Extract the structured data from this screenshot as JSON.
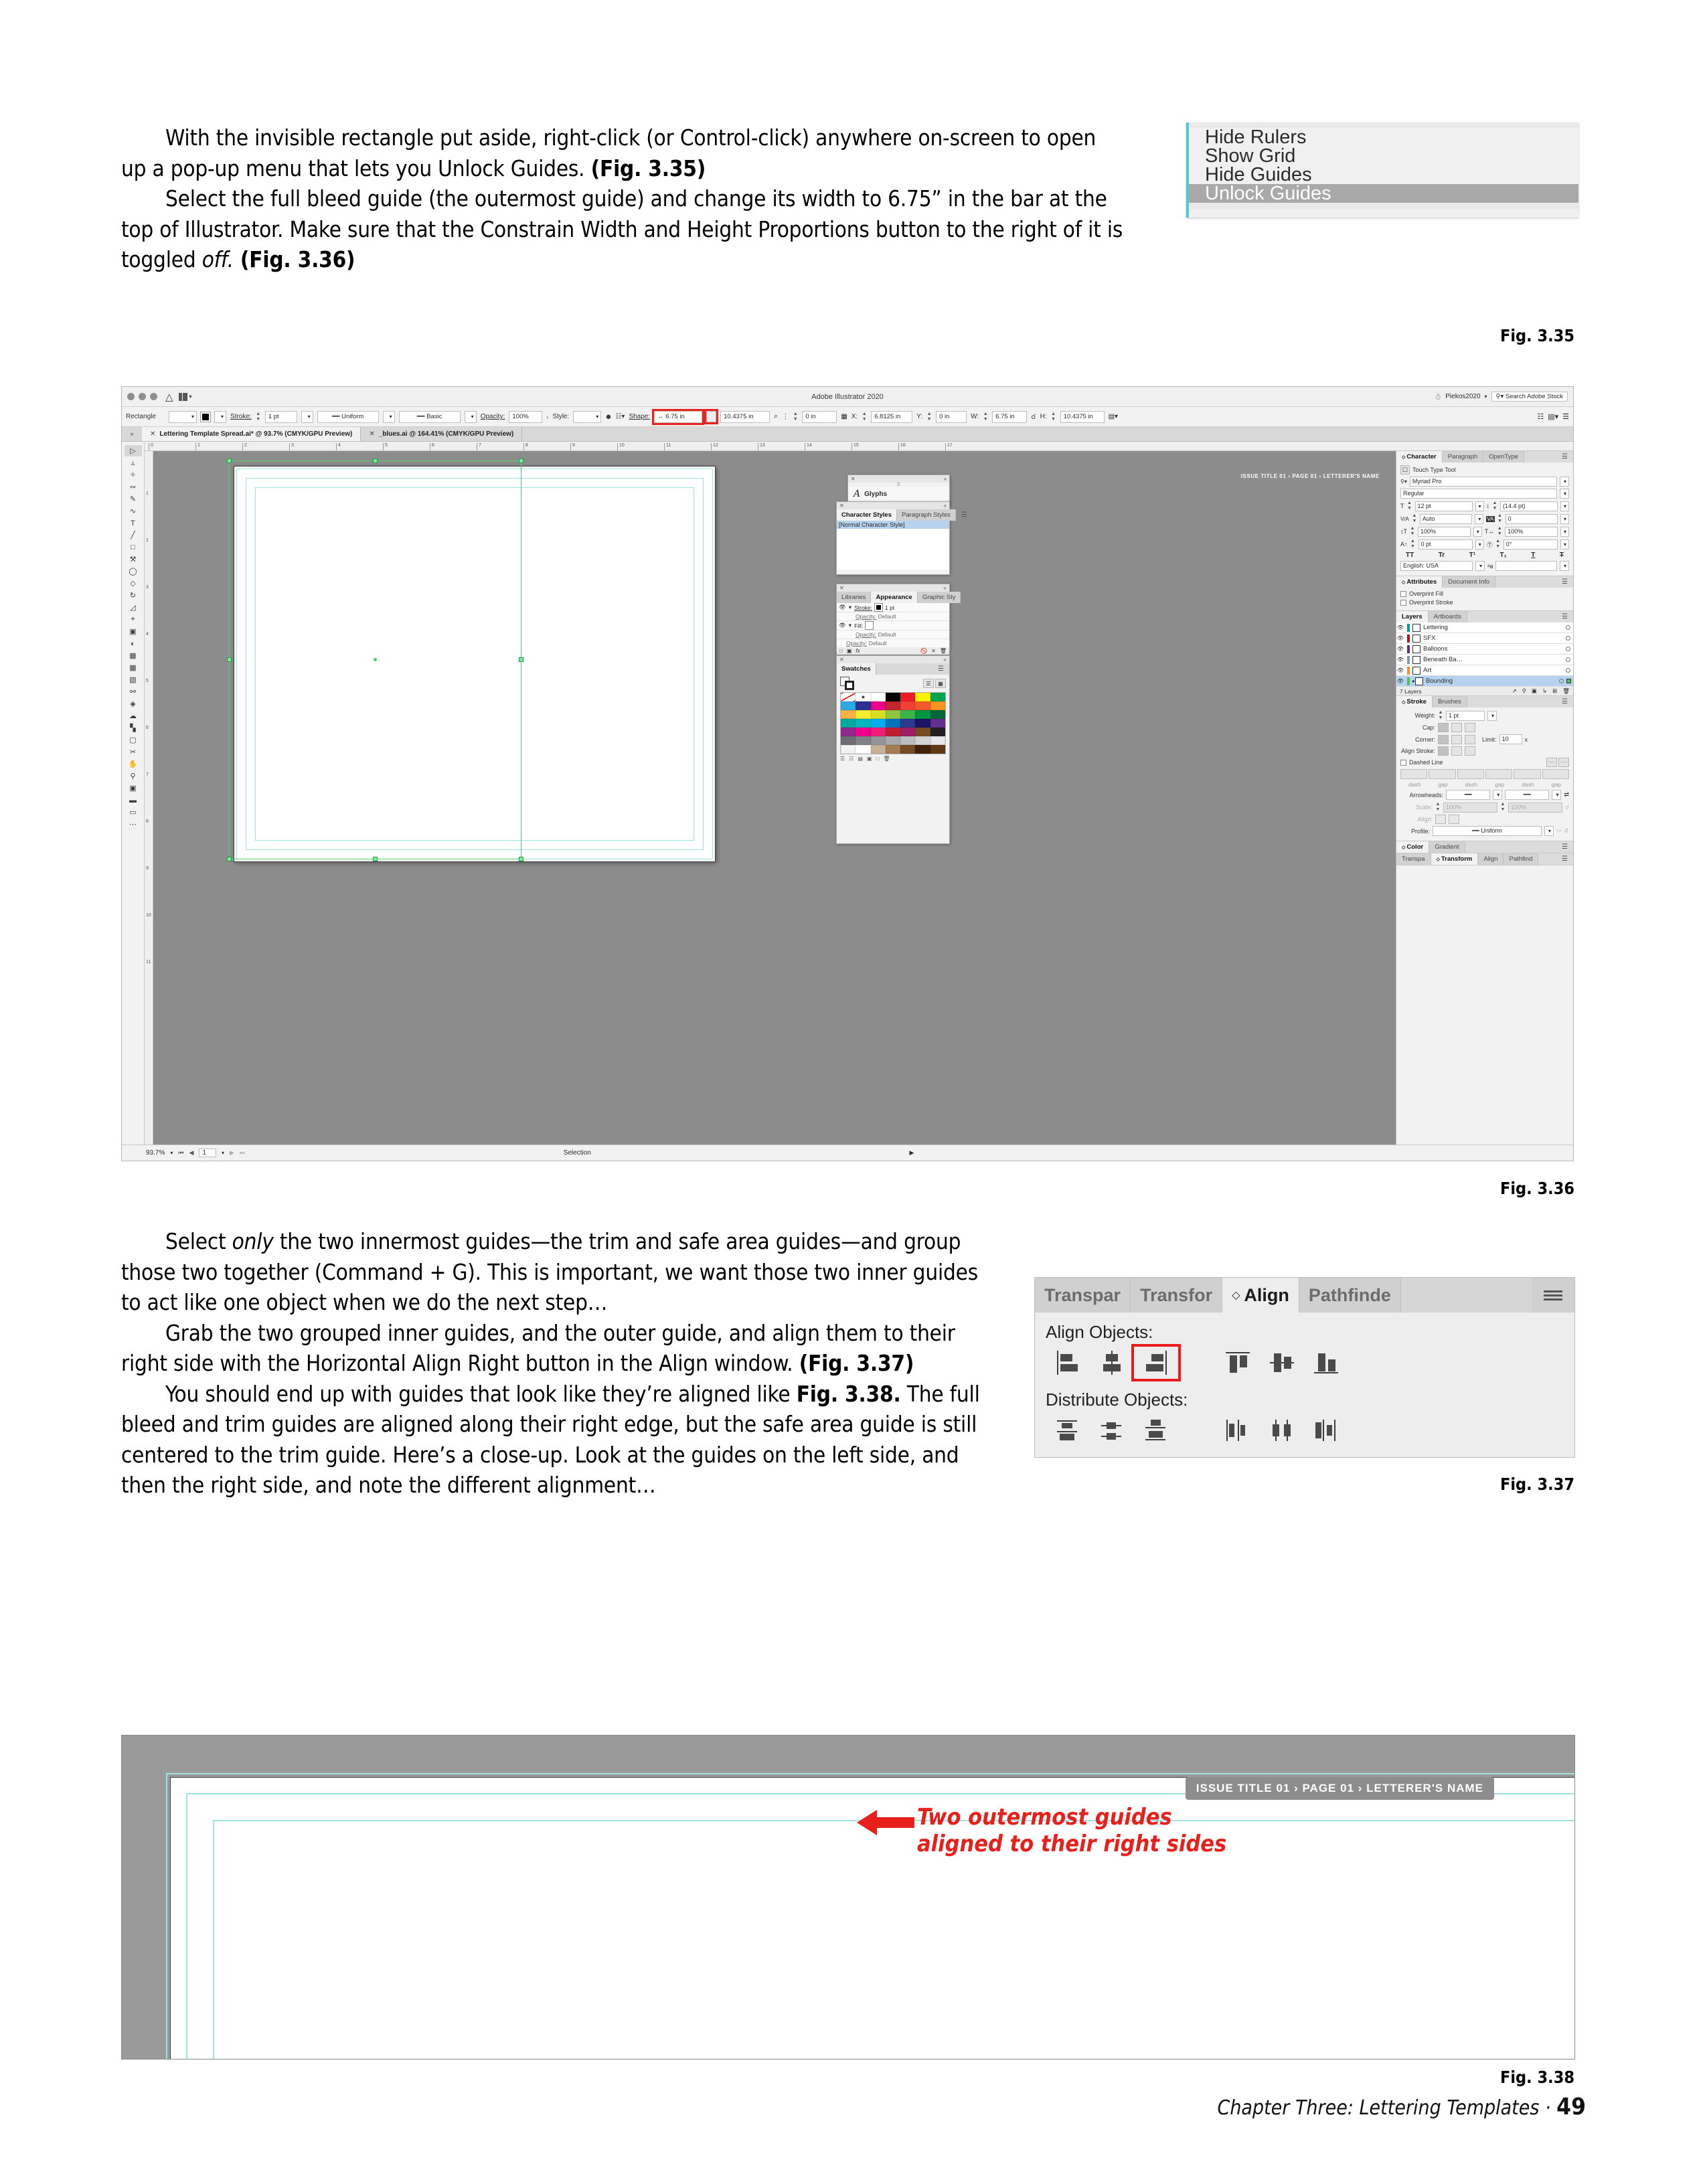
{
  "page": {
    "footer_chapter": "Chapter Three: Lettering Templates",
    "footer_sep": "·",
    "footer_page": "49"
  },
  "body": {
    "p1": "With the invisible rectangle put aside, right-click (or Control-click) anywhere on-screen to open up a pop-up menu that lets you Unlock Guides. ",
    "p1_fig": "(Fig. 3.35)",
    "p2a": "Select the full bleed guide (the outermost guide) and change its width to 6.75” in the bar at the top of Illustrator. Make sure that the Constrain Width and Height Proportions button to the right of it is toggled ",
    "p2_it": "off.",
    "p2_fig": " (Fig. 3.36)",
    "p3a": "Select ",
    "p3_it": "only",
    "p3b": " the two innermost guides—the trim and safe area guides—and group those two together (Command + G). This is important, we want those two inner guides to act like one object when we do the next step…",
    "p4a": "Grab the two grouped inner guides, and the outer guide, and align them to their right side with the Horizontal Align Right button in the Align window. ",
    "p4_fig": "(Fig. 3.37)",
    "p5a": "You should end up with guides that look like they’re aligned like ",
    "p5_fig": "Fig. 3.38.",
    "p5b": " The full bleed and trim guides are aligned along their right edge, but the safe area guide is still centered to the trim guide. Here’s a close-up. Look at the guides on the left side, and then the right side, and note the different alignment…"
  },
  "captions": {
    "fig335": "Fig. 3.35",
    "fig336": "Fig. 3.36",
    "fig337": "Fig. 3.37",
    "fig338": "Fig. 3.38"
  },
  "context_menu": {
    "items": [
      {
        "label": "Hide Rulers",
        "selected": false
      },
      {
        "label": "Show Grid",
        "selected": false
      },
      {
        "label": "Hide Guides",
        "selected": false
      },
      {
        "label": "Unlock Guides",
        "selected": true
      }
    ],
    "highlight_color": "#a9a9a9",
    "accent_color": "#57c6d4"
  },
  "illustrator": {
    "app_title": "Adobe Illustrator 2020",
    "account_name": "Piekos2020",
    "search_placeholder": "Search Adobe Stock",
    "home_icon": "home-icon",
    "workspace_icon": "workspace-switcher-icon",
    "lightbulb_icon": "discover-icon",
    "search_icon": "search-icon",
    "control_bar": {
      "object_type": "Rectangle",
      "stroke_label": "Stroke:",
      "stroke_weight": "1 pt",
      "profile": "Uniform",
      "brush": "Basic",
      "opacity_label": "Opacity:",
      "opacity_value": "100%",
      "style_label": "Style:",
      "shape_label": "Shape:",
      "width_value": "6.75 in",
      "height_value": "10.4375 in",
      "angle_value": "0 in",
      "x_label": "X:",
      "x_value": "6.8125 in",
      "y_label": "Y:",
      "y_value": "0 in",
      "w_label": "W:",
      "w_value": "6.75 in",
      "h_label": "H:",
      "h_value": "10.4375 in",
      "constrain_icon": "constrain-proportions-icon",
      "highlight_color": "#e8241f"
    },
    "document_tabs": [
      {
        "label": "Lettering Template Spread.ai* @ 93.7% (CMYK/GPU Preview)",
        "active": true
      },
      {
        "label": "_blues.ai @ 164.41% (CMYK/GPU Preview)",
        "active": false
      }
    ],
    "status_bar": {
      "zoom": "93.7%",
      "artboard": "1",
      "tool": "Selection"
    },
    "artboard_header": "ISSUE TITLE 01 › PAGE 01 › LETTERER'S NAME",
    "ruler_ticks": [
      "0",
      "1",
      "2",
      "3",
      "4",
      "5",
      "6",
      "7",
      "8",
      "9",
      "10",
      "11",
      "12",
      "13",
      "14",
      "15",
      "16",
      "17"
    ],
    "panels": {
      "glyphs": {
        "title": "Glyphs",
        "icon": "glyph-a-icon"
      },
      "char_styles": {
        "tabs": [
          "Character Styles",
          "Paragraph Styles"
        ],
        "active": "Character Styles",
        "items": [
          "[Normal Character Style]"
        ]
      },
      "appearance": {
        "tabs": [
          "Libraries",
          "Appearance",
          "Graphic Sty"
        ],
        "active": "Appearance",
        "rows": [
          {
            "label": "Stroke:",
            "value": "1 pt"
          },
          {
            "label": "Opacity:",
            "value": "Default"
          },
          {
            "label": "Fill:",
            "value": ""
          },
          {
            "label": "Opacity:",
            "value": "Default"
          },
          {
            "label": "Opacity:",
            "value": "Default"
          }
        ]
      },
      "swatches": {
        "title": "Swatches",
        "colors": [
          "none",
          "registration",
          "#ffffff",
          "#000000",
          "#ed1c24",
          "#fff200",
          "#00a651",
          "#29abe2",
          "#2e3192",
          "#ec008c",
          "#c1272d",
          "#ef4136",
          "#f15a29",
          "#f7941e",
          "#fbb040",
          "#f9ed32",
          "#d7df23",
          "#8dc63f",
          "#39b54a",
          "#009444",
          "#006838",
          "#00a99d",
          "#00b7bd",
          "#00aeef",
          "#0072bc",
          "#2b3990",
          "#1b1464",
          "#662d91",
          "#92278f",
          "#ec008c",
          "#ed1e79",
          "#be1e2d",
          "#9e1f63",
          "#754c24",
          "#231f20",
          "#6d6e71",
          "#808285",
          "#939598",
          "#a7a9ac",
          "#bcbec0",
          "#d1d3d4",
          "#e6e7e8",
          "#f1f2f2",
          "#ffffff",
          "#c7b299",
          "#a67c52",
          "#754c24",
          "#42210b",
          "#603913"
        ]
      },
      "character": {
        "tabs": [
          "Character",
          "Paragraph",
          "OpenType"
        ],
        "active": "Character",
        "touch_type_tool": "Touch Type Tool",
        "font_family": "Myriad Pro",
        "font_style": "Regular",
        "size": "12 pt",
        "leading": "(14.4 pt)",
        "kerning": "Auto",
        "tracking": "0",
        "vert_scale": "100%",
        "horiz_scale": "100%",
        "baseline_shift": "0 pt",
        "rotation": "0°",
        "language": "English: USA",
        "case_buttons": [
          "TT",
          "Tr",
          "T¹",
          "T₁",
          "T",
          "T"
        ]
      },
      "attributes": {
        "tabs": [
          "Attributes",
          "Document Info"
        ],
        "active": "Attributes",
        "overprint_fill": "Overprint Fill",
        "overprint_stroke": "Overprint Stroke"
      },
      "layers": {
        "tabs": [
          "Layers",
          "Artboards"
        ],
        "active": "Layers",
        "count_label": "7 Layers",
        "rows": [
          {
            "name": "Lettering",
            "color": "#009999",
            "selected": false
          },
          {
            "name": "SFX",
            "color": "#aa1122",
            "selected": false
          },
          {
            "name": "Balloons",
            "color": "#5b2d82",
            "selected": false
          },
          {
            "name": "Beneath Ba…",
            "color": "#8a8fd0",
            "selected": false
          },
          {
            "name": "Art",
            "color": "#f7941e",
            "selected": false
          },
          {
            "name": "Bounding",
            "color": "#4fc24f",
            "selected": true
          }
        ]
      },
      "stroke": {
        "tabs": [
          "Stroke",
          "Brushes"
        ],
        "active": "Stroke",
        "weight_label": "Weight:",
        "weight_value": "1 pt",
        "cap_label": "Cap:",
        "corner_label": "Corner:",
        "limit_label": "Limit:",
        "limit_value": "10",
        "limit_unit": "x",
        "align_stroke_label": "Align Stroke:",
        "dashed_line_label": "Dashed Line",
        "dash_labels": [
          "dash",
          "gap",
          "dash",
          "gap",
          "dash",
          "gap"
        ],
        "arrowheads_label": "Arrowheads:",
        "scale_label": "Scale:",
        "scale_values": [
          "100%",
          "100%"
        ],
        "align_label": "Align:",
        "profile_label": "Profile:",
        "profile_value": "Uniform"
      },
      "color": {
        "tabs": [
          "Color",
          "Gradient"
        ],
        "active": "Color"
      },
      "transform": {
        "tabs": [
          "Transpa",
          "Transform",
          "Align",
          "Pathfind"
        ],
        "active": "Transform"
      }
    }
  },
  "align_window": {
    "tabs": [
      {
        "label": "Transpar",
        "active": false
      },
      {
        "label": "Transfor",
        "active": false
      },
      {
        "label": "Align",
        "active": true
      },
      {
        "label": "Pathfinde",
        "active": false
      }
    ],
    "align_objects_label": "Align Objects:",
    "distribute_objects_label": "Distribute Objects:",
    "highlight_color": "#ec1c1c",
    "align_buttons": [
      "horizontal-align-left-icon",
      "horizontal-align-center-icon",
      "horizontal-align-right-icon",
      "vertical-align-top-icon",
      "vertical-align-center-icon",
      "vertical-align-bottom-icon"
    ],
    "distribute_buttons": [
      "vertical-distribute-top-icon",
      "vertical-distribute-center-icon",
      "vertical-distribute-bottom-icon",
      "horizontal-distribute-left-icon",
      "horizontal-distribute-center-icon",
      "horizontal-distribute-right-icon"
    ]
  },
  "closeup": {
    "header_text": "ISSUE TITLE 01 › PAGE 01 › LETTERER'S NAME",
    "annotation": "Two outermost guides\naligned to their right sides",
    "annotation_color": "#e8201c",
    "guide_color": "#9fe3e3"
  }
}
